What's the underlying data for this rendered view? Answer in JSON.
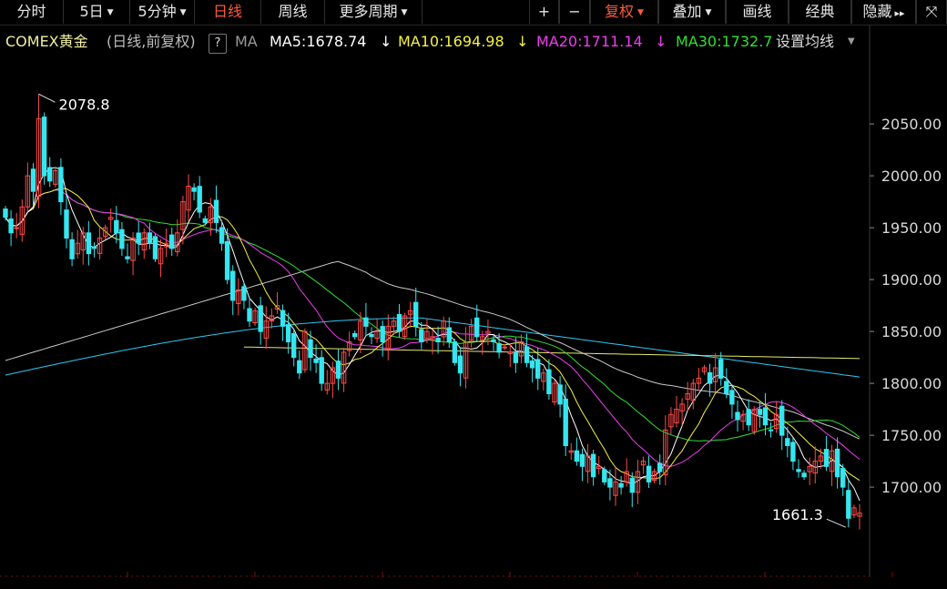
{
  "toolbar": {
    "tabs": [
      {
        "label": "分时",
        "active": false,
        "caret": false
      },
      {
        "label": "5日",
        "active": false,
        "caret": true
      },
      {
        "label": "5分钟",
        "active": false,
        "caret": true
      },
      {
        "label": "日线",
        "active": true,
        "caret": false
      },
      {
        "label": "周线",
        "active": false,
        "caret": false
      },
      {
        "label": "更多周期",
        "active": false,
        "caret": true
      }
    ],
    "right": [
      {
        "label": "+",
        "active": false,
        "caret": false
      },
      {
        "label": "−",
        "active": false,
        "caret": false
      },
      {
        "label": "复权",
        "active": true,
        "caret": true
      },
      {
        "label": "叠加",
        "active": false,
        "caret": true
      },
      {
        "label": "画线",
        "active": false,
        "caret": false
      },
      {
        "label": "经典",
        "active": false,
        "caret": false
      },
      {
        "label": "隐藏",
        "active": false,
        "caret": false
      },
      {
        "label": "⤧",
        "active": false,
        "caret": false
      }
    ],
    "hide_arrows": "▸▸"
  },
  "infobar": {
    "symbol": "COMEX黄金",
    "mode": "(日线,前复权)",
    "help": "?",
    "ma_label": "MA",
    "ma5": "MA5:1678.74",
    "ma10": "MA10:1694.98",
    "ma20": "MA20:1711.14",
    "ma30": "MA30:1732.7",
    "arrow": "↓",
    "settings": "设置均线"
  },
  "colors": {
    "up": "#ff4a4a",
    "down": "#35e6f0",
    "ma5": "#ffffff",
    "ma10": "#f5f242",
    "ma20": "#f03cf0",
    "ma30": "#30e030",
    "ma60": "#c8c8c8",
    "ma120": "#2ec8f0",
    "ma250": "#e8e870",
    "axis": "#d8d8d8",
    "grid": "#7a1010"
  },
  "chart_data": {
    "type": "candlestick",
    "ylim": [
      1615,
      2115
    ],
    "yticks": [
      1700,
      1750,
      1800,
      1850,
      1900,
      1950,
      2000,
      2050
    ],
    "ytick_labels": [
      "1700.00",
      "1750.00",
      "1800.00",
      "1850.00",
      "1900.00",
      "1950.00",
      "2000.00",
      "2050.00"
    ],
    "annotations": [
      {
        "label": "2078.8",
        "value": 2078.8,
        "index": 6
      },
      {
        "label": "1661.3",
        "value": 1661.3,
        "index": 152
      }
    ],
    "closes": [
      1960,
      1945,
      1950,
      1970,
      2000,
      1985,
      2055,
      2000,
      1995,
      2005,
      1975,
      1940,
      1920,
      1935,
      1945,
      1925,
      1930,
      1940,
      1950,
      1960,
      1945,
      1930,
      1920,
      1940,
      1935,
      1945,
      1935,
      1920,
      1930,
      1935,
      1930,
      1945,
      1975,
      1990,
      1985,
      1965,
      1955,
      1970,
      1955,
      1935,
      1900,
      1880,
      1890,
      1880,
      1860,
      1870,
      1850,
      1860,
      1865,
      1875,
      1855,
      1840,
      1825,
      1810,
      1850,
      1825,
      1820,
      1800,
      1800,
      1815,
      1805,
      1830,
      1840,
      1845,
      1860,
      1855,
      1845,
      1850,
      1840,
      1855,
      1860,
      1850,
      1865,
      1870,
      1855,
      1840,
      1850,
      1845,
      1840,
      1860,
      1840,
      1820,
      1810,
      1840,
      1855,
      1845,
      1845,
      1850,
      1840,
      1830,
      1835,
      1830,
      1820,
      1840,
      1820,
      1815,
      1805,
      1810,
      1790,
      1800,
      1780,
      1740,
      1735,
      1725,
      1720,
      1730,
      1710,
      1720,
      1705,
      1700,
      1705,
      1700,
      1715,
      1695,
      1715,
      1725,
      1705,
      1715,
      1715,
      1755,
      1770,
      1775,
      1780,
      1790,
      1800,
      1805,
      1815,
      1800,
      1815,
      1805,
      1790,
      1780,
      1765,
      1770,
      1760,
      1775,
      1770,
      1760,
      1755,
      1770,
      1750,
      1740,
      1725,
      1715,
      1710,
      1720,
      1725,
      1730,
      1720,
      1735,
      1710,
      1700,
      1670,
      1680,
      1675
    ]
  }
}
